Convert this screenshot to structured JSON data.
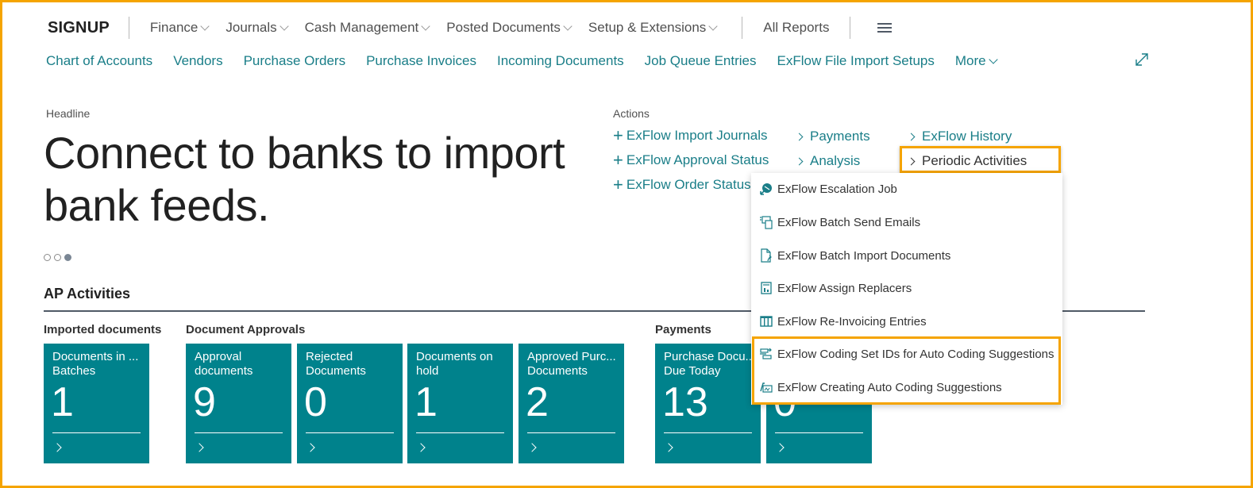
{
  "topnav": {
    "brand": "SIGNUP",
    "items": [
      {
        "label": "Finance",
        "dropdown": true
      },
      {
        "label": "Journals",
        "dropdown": true
      },
      {
        "label": "Cash Management",
        "dropdown": true
      },
      {
        "label": "Posted Documents",
        "dropdown": true
      },
      {
        "label": "Setup & Extensions",
        "dropdown": true
      }
    ],
    "all_reports": "All Reports",
    "menu_icon": "hamburger-icon"
  },
  "subnav": {
    "items": [
      "Chart of Accounts",
      "Vendors",
      "Purchase Orders",
      "Purchase Invoices",
      "Incoming Documents",
      "Job Queue Entries",
      "ExFlow File Import Setups"
    ],
    "more": "More",
    "expand_icon": "expand-icon"
  },
  "headline": {
    "label": "Headline",
    "text": "Connect to banks to import bank feeds.",
    "carousel": {
      "total": 3,
      "active": 3
    }
  },
  "actions": {
    "label": "Actions",
    "col1": [
      "ExFlow Import Journals",
      "ExFlow Approval Status",
      "ExFlow Order Status"
    ],
    "col2": [
      "Payments",
      "Analysis"
    ],
    "col3": [
      "ExFlow History",
      "Periodic Activities"
    ],
    "highlighted": "Periodic Activities"
  },
  "periodic_menu": {
    "items": [
      {
        "label": "ExFlow Escalation Job",
        "icon": "escalation-icon"
      },
      {
        "label": "ExFlow Batch Send Emails",
        "icon": "batch-email-icon"
      },
      {
        "label": "ExFlow Batch Import Documents",
        "icon": "document-import-icon"
      },
      {
        "label": "ExFlow Assign Replacers",
        "icon": "report-icon"
      },
      {
        "label": "ExFlow Re-Invoicing Entries",
        "icon": "table-icon"
      },
      {
        "label": "ExFlow Coding Set IDs for Auto Coding Suggestions",
        "icon": "coding-set-icon"
      },
      {
        "label": "ExFlow Creating Auto Coding Suggestions",
        "icon": "auto-coding-icon"
      }
    ],
    "highlighted": [
      "ExFlow Coding Set IDs for Auto Coding Suggestions",
      "ExFlow Creating Auto Coding Suggestions"
    ]
  },
  "ap_activities": {
    "title": "AP Activities",
    "groups": [
      {
        "label": "Imported documents"
      },
      {
        "label": "Document Approvals"
      },
      {
        "label": "Payments"
      }
    ],
    "tiles": [
      {
        "group": "Imported documents",
        "title": "Documents in ... Batches",
        "line1": "Documents in ...",
        "line2": "Batches",
        "value": "1"
      },
      {
        "group": "Document Approvals",
        "title": "Approval documents",
        "line1": "Approval",
        "line2": "documents",
        "value": "9"
      },
      {
        "group": "Document Approvals",
        "title": "Rejected Documents",
        "line1": "Rejected",
        "line2": "Documents",
        "value": "0"
      },
      {
        "group": "Document Approvals",
        "title": "Documents on hold",
        "line1": "Documents on",
        "line2": "hold",
        "value": "1"
      },
      {
        "group": "Document Approvals",
        "title": "Approved Purc... Documents",
        "line1": "Approved Purc...",
        "line2": "Documents",
        "value": "2"
      },
      {
        "group": "Payments",
        "title": "Purchase Docu... Due Today",
        "line1": "Purchase Docu...",
        "line2": "Due Today",
        "value": "13"
      },
      {
        "group": "Payments",
        "title": "",
        "line1": "",
        "line2": "",
        "value": "0"
      }
    ]
  },
  "colors": {
    "accent": "#1a7e88",
    "tile": "#00828c",
    "highlight": "#f5a400",
    "rule": "#505a66"
  }
}
